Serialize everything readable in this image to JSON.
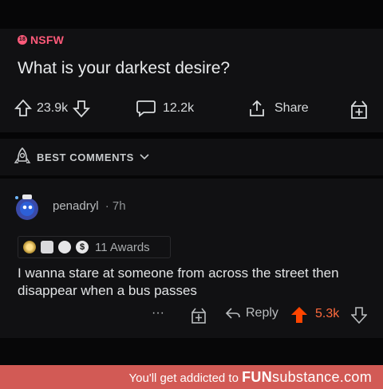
{
  "post": {
    "nsfw_badge": "NSFW",
    "title": "What is your darkest desire?",
    "upvotes": "23.9k",
    "comments": "12.2k",
    "share_label": "Share"
  },
  "sort": {
    "label": "BEST COMMENTS"
  },
  "comment": {
    "username": "penadryl",
    "time": "· 7h",
    "awards_label": "11 Awards",
    "text": "I wanna stare at someone from across the street then disappear when a bus passes",
    "reply_label": "Reply",
    "score": "5.3k",
    "more": "···"
  },
  "footer": {
    "text": "You'll get addicted to",
    "brand_fun": "FUN",
    "brand_rest": "substance",
    "brand_tld": ".com"
  },
  "colors": {
    "nsfw": "#ff5a7a",
    "upvote": "#ff4500",
    "score": "#ff6a3d",
    "footer_bg": "#d25a55"
  }
}
